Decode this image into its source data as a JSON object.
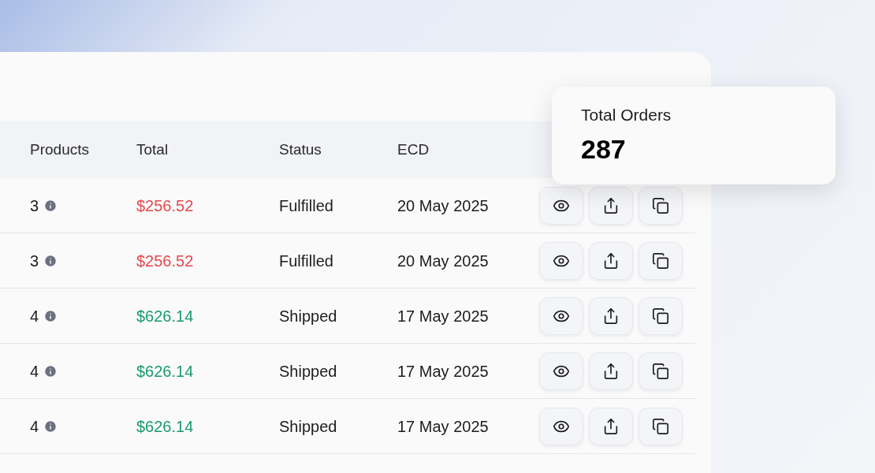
{
  "table": {
    "columns": [
      "Products",
      "Total",
      "Status",
      "ECD"
    ],
    "rows": [
      {
        "products": "3",
        "total": {
          "text": "$256.52",
          "color": "#e5484d"
        },
        "status": "Fulfilled",
        "ecd": "20 May 2025"
      },
      {
        "products": "3",
        "total": {
          "text": "$256.52",
          "color": "#e5484d"
        },
        "status": "Fulfilled",
        "ecd": "20 May 2025"
      },
      {
        "products": "4",
        "total": {
          "text": "$626.14",
          "color": "#1a9a6c"
        },
        "status": "Shipped",
        "ecd": "17 May 2025"
      },
      {
        "products": "4",
        "total": {
          "text": "$626.14",
          "color": "#1a9a6c"
        },
        "status": "Shipped",
        "ecd": "17 May 2025"
      },
      {
        "products": "4",
        "total": {
          "text": "$626.14",
          "color": "#1a9a6c"
        },
        "status": "Shipped",
        "ecd": "17 May 2025"
      }
    ]
  },
  "summary_card": {
    "title": "Total Orders",
    "value": "287"
  }
}
